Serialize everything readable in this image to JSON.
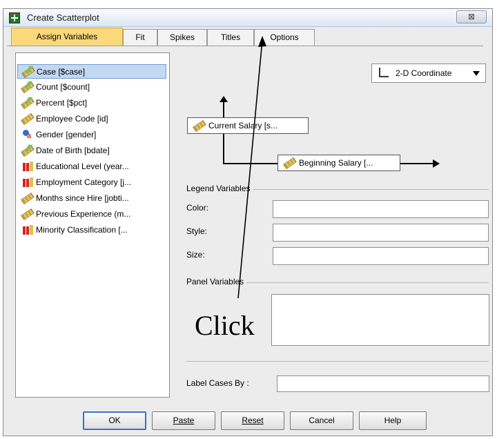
{
  "dialog": {
    "title": "Create Scatterplot",
    "close_label": "⊠"
  },
  "tabs": [
    {
      "label": "Assign Variables",
      "active": true
    },
    {
      "label": "Fit",
      "active": false
    },
    {
      "label": "Spikes",
      "active": false
    },
    {
      "label": "Titles",
      "active": false
    },
    {
      "label": "Options",
      "active": false
    }
  ],
  "variables": [
    {
      "label": "Case [$case]",
      "icon": "scale-multi-icon",
      "selected": true
    },
    {
      "label": "Count [$count]",
      "icon": "scale-multi-icon"
    },
    {
      "label": "Percent [$pct]",
      "icon": "scale-multi-icon"
    },
    {
      "label": "Employee Code [id]",
      "icon": "scale-ruler-icon"
    },
    {
      "label": "Gender [gender]",
      "icon": "nominal-icon"
    },
    {
      "label": "Date of Birth [bdate]",
      "icon": "scale-multi-icon"
    },
    {
      "label": "Educational Level (year...",
      "icon": "ordinal-bars-icon"
    },
    {
      "label": "Employment Category [j...",
      "icon": "ordinal-bars-icon"
    },
    {
      "label": "Months since Hire [jobti...",
      "icon": "scale-ruler-icon"
    },
    {
      "label": "Previous Experience (m...",
      "icon": "scale-ruler-icon"
    },
    {
      "label": "Minority Classification [...",
      "icon": "ordinal-bars-icon"
    }
  ],
  "coordinate": {
    "label": "2-D Coordinate"
  },
  "axes": {
    "y_variable": "Current Salary [s...",
    "x_variable": "Beginning Salary [..."
  },
  "legend": {
    "heading": "Legend Variables",
    "color_label": "Color:",
    "style_label": "Style:",
    "size_label": "Size:"
  },
  "panel": {
    "heading": "Panel Variables"
  },
  "label_cases": {
    "label": "Label Cases By :"
  },
  "buttons": {
    "ok": "OK",
    "paste": "Paste",
    "reset": "Reset",
    "cancel": "Cancel",
    "help": "Help"
  },
  "annotation": {
    "text": "Click"
  }
}
